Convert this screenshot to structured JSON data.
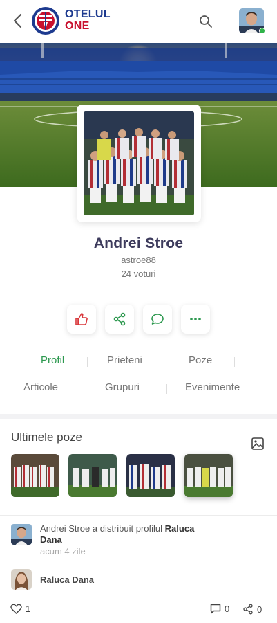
{
  "header": {
    "logo_line1": "OTELUL",
    "logo_line2": "ONE",
    "back_icon": "back-arrow-icon",
    "search_icon": "search-icon"
  },
  "profile": {
    "name": "Andrei Stroe",
    "username": "astroe88",
    "votes": "24 voturi"
  },
  "actions": [
    {
      "icon": "thumbs-up-icon"
    },
    {
      "icon": "share-icon"
    },
    {
      "icon": "chat-icon"
    },
    {
      "icon": "more-icon"
    }
  ],
  "tabs": {
    "row1": [
      "Profil",
      "Prieteni",
      "Poze"
    ],
    "row2": [
      "Articole",
      "Grupuri",
      "Evenimente"
    ],
    "active": "Profil"
  },
  "photos": {
    "title": "Ultimele poze"
  },
  "feed": {
    "item1_actor": "Andrei Stroe",
    "item1_text": "a distribuit profilul",
    "item1_target_a": "Raluca",
    "item1_target_b": "Dana",
    "item1_time": "acum 4 zile",
    "item2_name": "Raluca Dana"
  },
  "bottom": {
    "likes": "1",
    "comments": "0",
    "shares": "0"
  },
  "colors": {
    "accent_green": "#2e9950",
    "like_red": "#d9373b",
    "brand_blue": "#1d3a8f",
    "brand_red": "#c8102e"
  }
}
